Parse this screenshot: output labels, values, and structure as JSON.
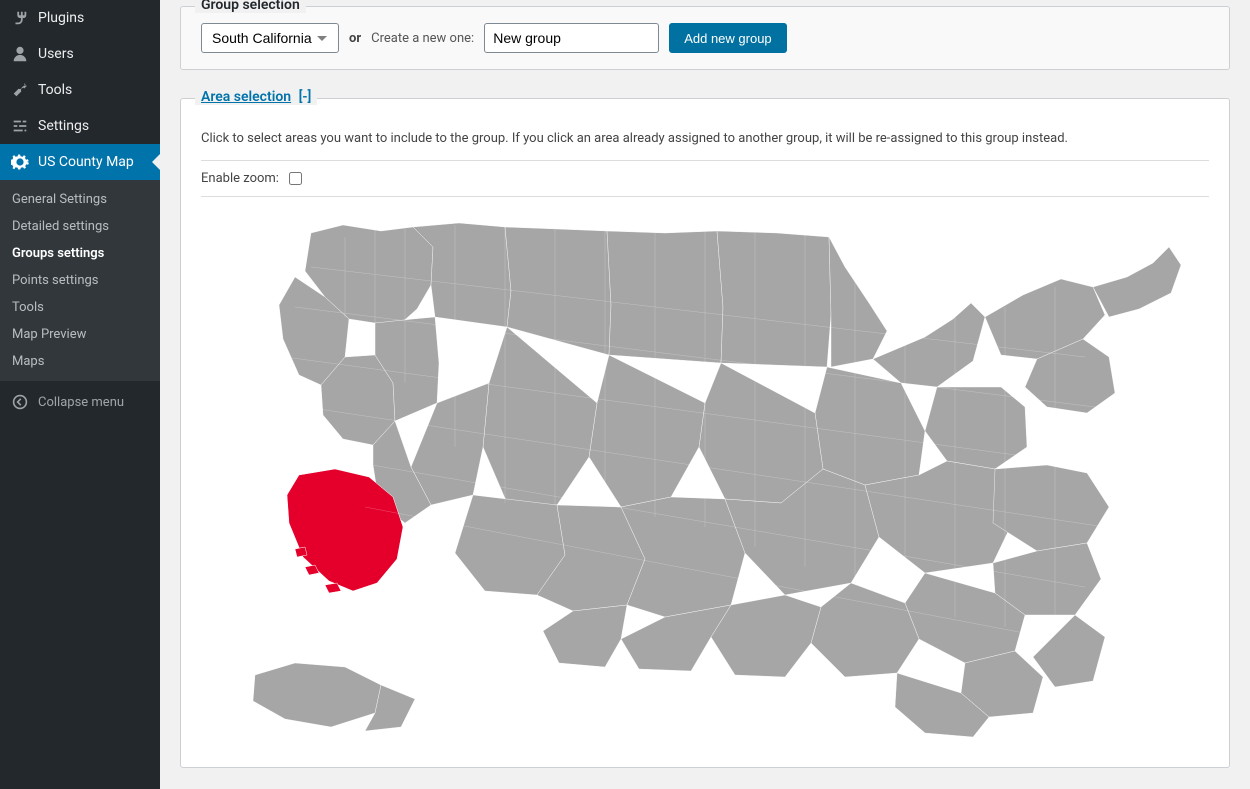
{
  "sidebar": {
    "plugins": "Plugins",
    "users": "Users",
    "tools": "Tools",
    "settings": "Settings",
    "active": "US County Map",
    "submenu": {
      "general": "General Settings",
      "detailed": "Detailed settings",
      "groups": "Groups settings",
      "points": "Points settings",
      "tools": "Tools",
      "preview": "Map Preview",
      "maps": "Maps"
    },
    "collapse": "Collapse menu"
  },
  "group_panel": {
    "legend": "Group selection",
    "selected": "South California",
    "or": "or",
    "create_label": "Create a new one:",
    "new_group_value": "New group",
    "add_button": "Add new group"
  },
  "area_panel": {
    "legend_link": "Area selection",
    "legend_toggle": "[-]",
    "help": "Click to select areas you want to include to the group. If you click an area already assigned to another group, it will be re-assigned to this group instead.",
    "zoom_label": "Enable zoom:",
    "zoom_checked": false
  },
  "colors": {
    "accent": "#0073aa",
    "button": "#0071a1",
    "map_default": "#a6a6a6",
    "map_selected": "#e4002b"
  }
}
